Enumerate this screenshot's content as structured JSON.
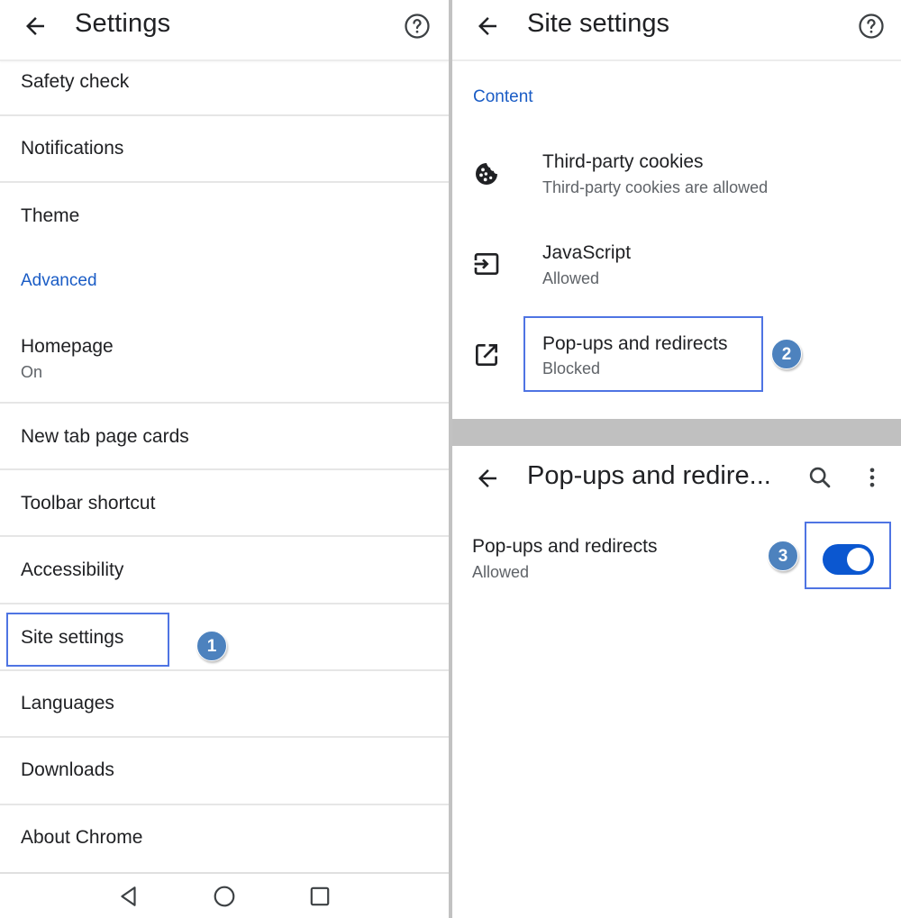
{
  "left_panel": {
    "app_bar": {
      "title": "Settings",
      "back_icon": "arrow-back-icon",
      "help_icon": "help-circle-icon"
    },
    "items": [
      {
        "label": "Safety check"
      },
      {
        "label": "Notifications"
      },
      {
        "label": "Theme"
      },
      {
        "section_header": "Advanced"
      },
      {
        "label": "Homepage",
        "sub": "On"
      },
      {
        "label": "New tab page cards"
      },
      {
        "label": "Toolbar shortcut"
      },
      {
        "label": "Accessibility"
      },
      {
        "label": "Site settings",
        "highlighted": true,
        "step": "1"
      },
      {
        "label": "Languages"
      },
      {
        "label": "Downloads"
      },
      {
        "label": "About Chrome"
      }
    ],
    "nav_bar": {
      "back": "nav-back-triangle-icon",
      "home": "nav-home-circle-icon",
      "recents": "nav-recents-square-icon"
    }
  },
  "site_settings_panel": {
    "app_bar": {
      "title": "Site settings",
      "back_icon": "arrow-back-icon",
      "help_icon": "help-circle-icon"
    },
    "section_header": "Content",
    "items": [
      {
        "icon": "cookie-icon",
        "label": "Third-party cookies",
        "sub": "Third-party cookies are allowed"
      },
      {
        "icon": "javascript-input-icon",
        "label": "JavaScript",
        "sub": "Allowed"
      },
      {
        "icon": "open-in-new-icon",
        "label": "Pop-ups and redirects",
        "sub": "Blocked",
        "highlighted": true,
        "step": "2"
      }
    ]
  },
  "popups_panel": {
    "app_bar": {
      "title": "Pop-ups and redire...",
      "back_icon": "arrow-back-icon",
      "search_icon": "search-icon",
      "more_icon": "more-vert-icon"
    },
    "setting": {
      "label": "Pop-ups and redirects",
      "sub": "Allowed",
      "toggle_on": true,
      "step": "3"
    }
  },
  "colors": {
    "accent_blue": "#1a5cc5",
    "toggle_on": "#0b57d0",
    "highlight_box": "#4f74e3",
    "step_badge": "#4d82be",
    "separator_gray": "#c0c0c0"
  }
}
